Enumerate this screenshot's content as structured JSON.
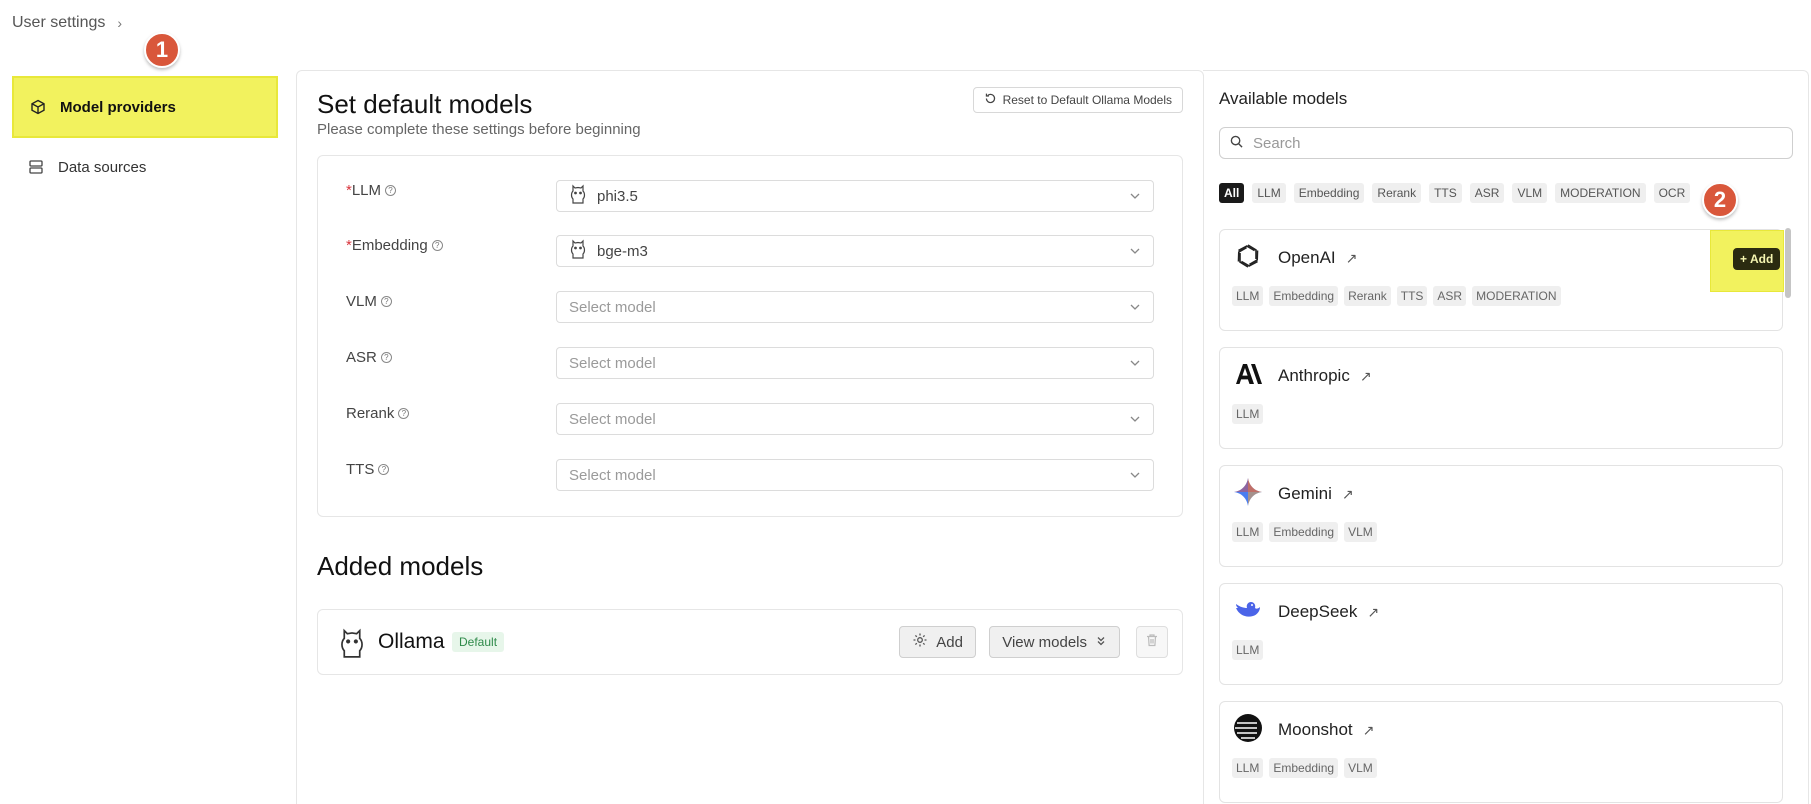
{
  "breadcrumb": {
    "label": "User settings",
    "chevron": "›"
  },
  "markers": {
    "one": "1",
    "two": "2"
  },
  "sidebar": {
    "items": [
      {
        "label": "Model providers",
        "icon": "cube-icon",
        "active": true
      },
      {
        "label": "Data sources",
        "icon": "database-icon",
        "active": false
      }
    ]
  },
  "defaults": {
    "title": "Set default models",
    "subtitle": "Please complete these settings before beginning",
    "reset_label": "Reset to Default Ollama Models",
    "rows": [
      {
        "label": "LLM",
        "required": "*",
        "value": "phi3.5",
        "placeholder": ""
      },
      {
        "label": "Embedding",
        "required": "*",
        "value": "bge-m3",
        "placeholder": ""
      },
      {
        "label": "VLM",
        "required": "",
        "value": "",
        "placeholder": "Select model"
      },
      {
        "label": "ASR",
        "required": "",
        "value": "",
        "placeholder": "Select model"
      },
      {
        "label": "Rerank",
        "required": "",
        "value": "",
        "placeholder": "Select model"
      },
      {
        "label": "TTS",
        "required": "",
        "value": "",
        "placeholder": "Select model"
      }
    ]
  },
  "added": {
    "title": "Added models",
    "provider": "Ollama",
    "badge": "Default",
    "add_label": "Add",
    "view_label": "View models"
  },
  "available": {
    "title": "Available models",
    "search_placeholder": "Search",
    "filters": [
      "All",
      "LLM",
      "Embedding",
      "Rerank",
      "TTS",
      "ASR",
      "VLM",
      "MODERATION",
      "OCR"
    ],
    "add_label": "Add",
    "providers": [
      {
        "name": "OpenAI",
        "tags": [
          "LLM",
          "Embedding",
          "Rerank",
          "TTS",
          "ASR",
          "MODERATION"
        ]
      },
      {
        "name": "Anthropic",
        "tags": [
          "LLM"
        ]
      },
      {
        "name": "Gemini",
        "tags": [
          "LLM",
          "Embedding",
          "VLM"
        ]
      },
      {
        "name": "DeepSeek",
        "tags": [
          "LLM"
        ]
      },
      {
        "name": "Moonshot",
        "tags": [
          "LLM",
          "Embedding",
          "VLM"
        ]
      }
    ]
  },
  "colors": {
    "highlight": "#f2f25e",
    "marker": "#d9573b",
    "required": "#d9363e"
  }
}
